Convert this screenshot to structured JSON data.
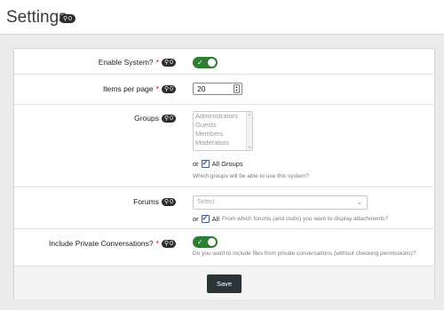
{
  "header": {
    "title": "Settings",
    "badge_icon": "search-icon",
    "badge_count": "0"
  },
  "badge": {
    "icon": "search-icon",
    "count": "0"
  },
  "fields": {
    "enable_system": {
      "label": "Enable System?",
      "required": "*",
      "checked": true
    },
    "items_per_page": {
      "label": "Items per page",
      "required": "*",
      "value": "20"
    },
    "groups": {
      "label": "Groups",
      "options": [
        "Administrators",
        "Guests",
        "Members",
        "Moderators"
      ],
      "or_label": "or",
      "all_label": "All Groups",
      "all_checked": true,
      "hint": "Which groups will be able to use this system?"
    },
    "forums": {
      "label": "Forums",
      "placeholder": "Select",
      "or_label": "or",
      "all_label": "All",
      "all_checked": true,
      "hint": "From which forums (and clubs) you want to display attachments?"
    },
    "private_conversations": {
      "label": "Include Private Conversations?",
      "required": "*",
      "checked": true,
      "hint": "Do you want to include files from private conversations (without checking permissions)?"
    }
  },
  "footer": {
    "save_label": "Save"
  },
  "colors": {
    "toggle_on": "#2e7d32",
    "required": "#d0021b",
    "save_button": "#2b3438"
  }
}
